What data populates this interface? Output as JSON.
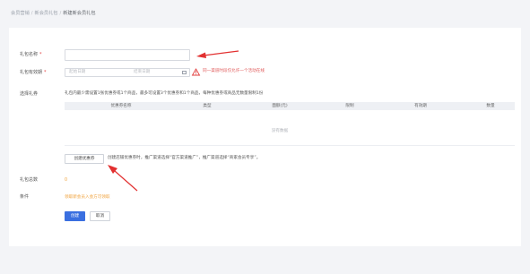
{
  "breadcrumb": {
    "items": [
      "会员营销",
      "新会员礼包",
      "新建新会员礼包"
    ],
    "separator": "/"
  },
  "form": {
    "gift_name": {
      "label": "礼包名称",
      "required_mark": "*",
      "value": ""
    },
    "validity": {
      "label": "礼包有效期",
      "required_mark": "*",
      "start_placeholder": "起始日期",
      "end_placeholder": "结束日期",
      "warning_text": "同一渠道时段仅允许一个活动在线"
    },
    "select_gift": {
      "label": "选择礼券",
      "note": "礼包内最少需设置1张优惠券或1个商品，最多可设置3个优惠券和1个商品，每种优惠券或商品无数量限制1份",
      "table": {
        "columns": [
          "优惠券名称",
          "类型",
          "面额(元)",
          "限制",
          "有效期",
          "数量"
        ],
        "empty_text": "没有数据"
      },
      "create_coupon_button": "创建优惠券",
      "create_coupon_hint": "创建店铺优惠券时，推广渠道选择“官方渠道推广”，推广渠道选择“商家会员专享”。"
    },
    "gift_total": {
      "label": "礼包总数",
      "value": "0"
    },
    "condition": {
      "label": "条件",
      "value": "领取新会员入会方可领取"
    }
  },
  "actions": {
    "create_label": "创建",
    "cancel_label": "取消"
  },
  "colors": {
    "accent": "#3a6fe0",
    "warning": "#e23d3d",
    "value_orange": "#f0a23c"
  }
}
